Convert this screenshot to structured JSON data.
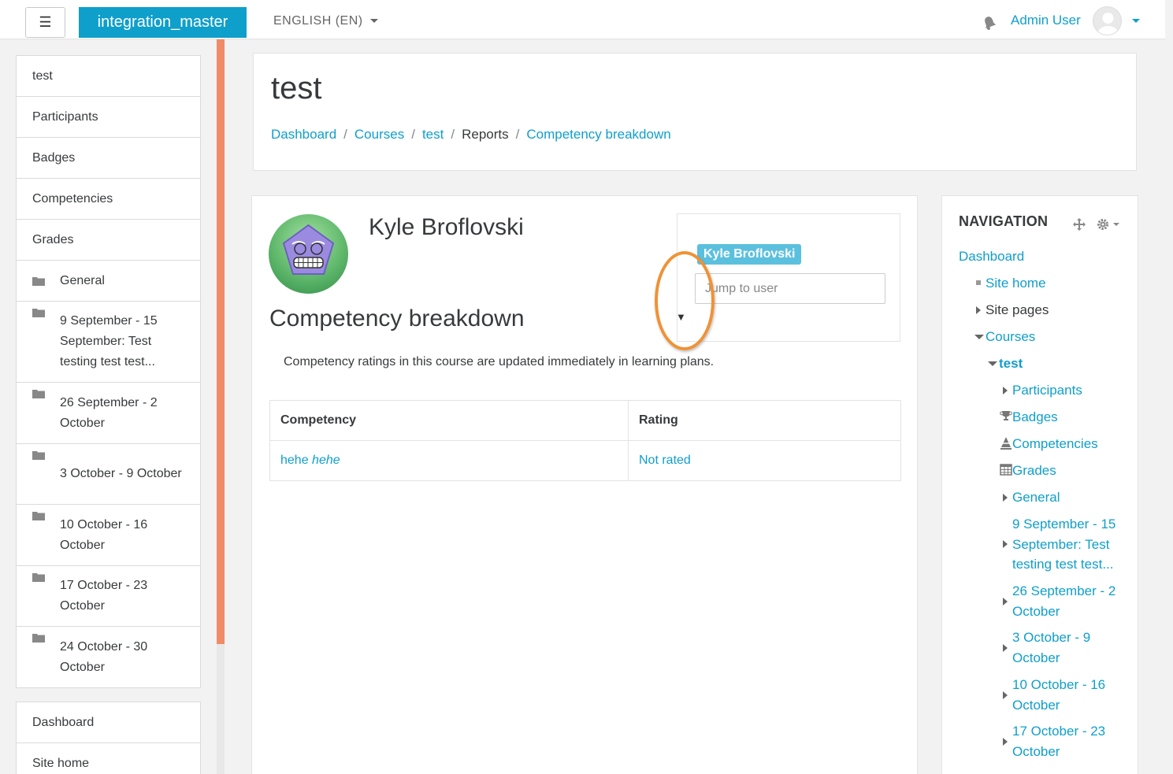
{
  "navbar": {
    "menu_icon": "☰",
    "brand": "integration_master",
    "language": "ENGLISH (EN)",
    "user_name": "Admin User"
  },
  "drawer": {
    "course_items": [
      {
        "label": "test",
        "icon": ""
      },
      {
        "label": "Participants",
        "icon": ""
      },
      {
        "label": "Badges",
        "icon": ""
      },
      {
        "label": "Competencies",
        "icon": ""
      },
      {
        "label": "Grades",
        "icon": ""
      },
      {
        "label": "General",
        "icon": "folder-icon"
      },
      {
        "label": "9 September - 15 September: Test testing test test...",
        "icon": "folder-icon"
      },
      {
        "label": "26 September - 2 October",
        "icon": "folder-icon"
      },
      {
        "label": "3 October - 9 October",
        "icon": "folder-icon"
      },
      {
        "label": "10 October - 16 October",
        "icon": "folder-icon"
      },
      {
        "label": "17 October - 23 October",
        "icon": "folder-icon"
      },
      {
        "label": "24 October - 30 October",
        "icon": "folder-icon"
      }
    ],
    "site_items": [
      {
        "label": "Dashboard"
      },
      {
        "label": "Site home"
      }
    ]
  },
  "header": {
    "title": "test",
    "breadcrumb": [
      {
        "label": "Dashboard",
        "link": true
      },
      {
        "label": "Courses",
        "link": true
      },
      {
        "label": "test",
        "link": true
      },
      {
        "label": "Reports",
        "link": false
      },
      {
        "label": "Competency breakdown",
        "link": true
      }
    ]
  },
  "main": {
    "student_name": "Kyle Broflovski",
    "section_title": "Competency breakdown",
    "dropdown_caret": "▼",
    "jump_tag": "Kyle Broflovski",
    "jump_placeholder": "Jump to user",
    "info": "Competency ratings in this course are updated immediately in learning plans.",
    "table": {
      "headers": [
        "Competency",
        "Rating"
      ],
      "rows": [
        {
          "competency": "hehe",
          "competency_italic": "hehe",
          "rating": "Not rated"
        }
      ]
    }
  },
  "navigation": {
    "title": "NAVIGATION",
    "items": [
      {
        "label": "Dashboard",
        "marker": "none",
        "style": "link"
      },
      {
        "label": "Site home",
        "marker": "square",
        "style": "link"
      },
      {
        "label": "Site pages",
        "marker": "tri-right",
        "style": "dark"
      },
      {
        "label": "Courses",
        "marker": "tri-down",
        "style": "link"
      },
      {
        "label": "test",
        "marker": "tri-down",
        "style": "bold"
      },
      {
        "label": "Participants",
        "marker": "tri-right",
        "style": "link"
      },
      {
        "label": "Badges",
        "marker": "trophy-icon",
        "style": "link"
      },
      {
        "label": "Competencies",
        "marker": "competency-icon",
        "style": "link"
      },
      {
        "label": "Grades",
        "marker": "table-icon",
        "style": "link"
      },
      {
        "label": "General",
        "marker": "tri-right",
        "style": "link"
      },
      {
        "label": "9 September - 15 September: Test testing test test...",
        "marker": "tri-right",
        "style": "link"
      },
      {
        "label": "26 September - 2 October",
        "marker": "tri-right",
        "style": "link"
      },
      {
        "label": "3 October - 9 October",
        "marker": "tri-right",
        "style": "link"
      },
      {
        "label": "10 October - 16 October",
        "marker": "tri-right",
        "style": "link"
      },
      {
        "label": "17 October - 23 October",
        "marker": "tri-right",
        "style": "link"
      }
    ]
  },
  "colors": {
    "accent": "#0f9fcb",
    "drawer_bar": "#ef8c67",
    "highlight": "#f09236",
    "tag": "#5bc0de"
  }
}
